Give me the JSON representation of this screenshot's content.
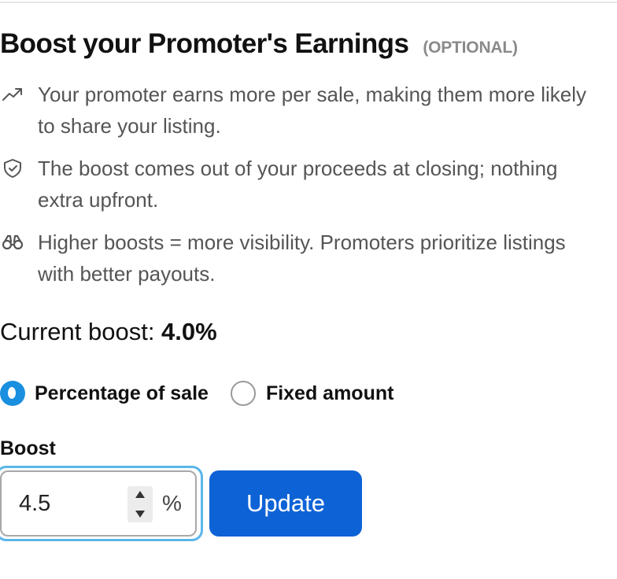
{
  "section": {
    "title": "Boost your Promoter's Earnings",
    "optional_tag": "(OPTIONAL)"
  },
  "bullets": [
    {
      "icon": "trend-up-icon",
      "text": "Your promoter earns more per sale, making them more likely to share your listing."
    },
    {
      "icon": "shield-check-icon",
      "text": "The boost comes out of your proceeds at closing; nothing extra upfront."
    },
    {
      "icon": "binoculars-icon",
      "text": "Higher boosts = more visibility. Promoters prioritize listings with better payouts."
    }
  ],
  "current_boost": {
    "label": "Current boost: ",
    "value": "4.0%"
  },
  "boost_type": {
    "options": [
      "Percentage of sale",
      "Fixed amount"
    ],
    "selected": "Percentage of sale"
  },
  "boost_field": {
    "label": "Boost",
    "value": "4.5",
    "unit": "%"
  },
  "actions": {
    "update_label": "Update"
  },
  "colors": {
    "accent": "#0d63d6",
    "radio_selected": "#1a8fe0",
    "focus_ring": "#5ab6ea",
    "muted_text": "#555555"
  }
}
